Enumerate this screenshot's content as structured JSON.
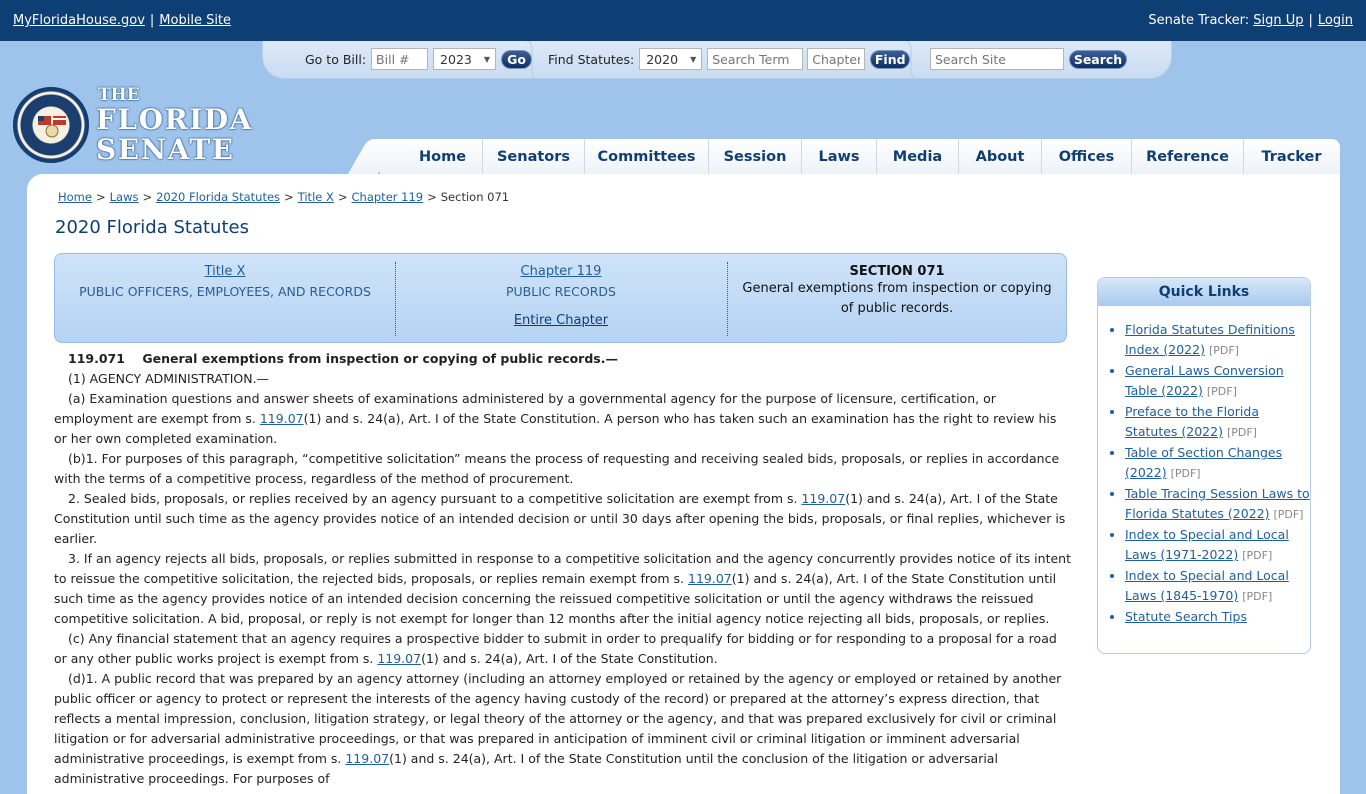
{
  "topbar": {
    "left_link_1": "MyFloridaHouse.gov",
    "left_sep": "|",
    "left_link_2": "Mobile Site",
    "right_label": "Senate Tracker:",
    "right_link_1": "Sign Up",
    "right_sep": "|",
    "right_link_2": "Login"
  },
  "tray": {
    "goto_label": "Go to Bill:",
    "bill_placeholder": "Bill #",
    "bill_year": "2023",
    "go_label": "Go",
    "find_label": "Find Statutes:",
    "statute_year": "2020",
    "term_placeholder": "Search Term",
    "chapter_placeholder": "Chapter",
    "find_button": "Find",
    "site_placeholder": "Search Site",
    "search_button": "Search"
  },
  "logo": {
    "the": "THE",
    "florida": "FLORIDA",
    "senate": "SENATE"
  },
  "nav": [
    "Home",
    "Senators",
    "Committees",
    "Session",
    "Laws",
    "Media",
    "About",
    "Offices",
    "Reference",
    "Tracker"
  ],
  "breadcrumb": {
    "home": "Home",
    "laws": "Laws",
    "statutes": "2020 Florida Statutes",
    "title": "Title X",
    "chapter": "Chapter 119",
    "current": "Section 071",
    "gt": ">"
  },
  "page_title": "2020 Florida Statutes",
  "heading": {
    "title_link": "Title X",
    "title_name": "PUBLIC OFFICERS, EMPLOYEES, AND RECORDS",
    "chapter_link": "Chapter 119",
    "chapter_name": "PUBLIC RECORDS",
    "entire_chapter": "Entire Chapter",
    "section_label": "SECTION 071",
    "section_name": "General exemptions from inspection or copying of public records."
  },
  "statute": {
    "number": "119.071",
    "catchline": "General exemptions from inspection or copying of public records.—",
    "p1": "(1)    AGENCY ADMINISTRATION.—",
    "p2a": "(a)    Examination questions and answer sheets of examinations administered by a governmental agency for the purpose of licensure, certification, or employment are exempt from s. ",
    "p2link": "119.07",
    "p2b": "(1) and s. 24(a), Art. I of the State Constitution. A person who has taken such an examination has the right to review his or her own completed examination.",
    "p3": "(b)1.    For purposes of this paragraph, “competitive solicitation” means the process of requesting and receiving sealed bids, proposals, or replies in accordance with the terms of a competitive process, regardless of the method of procurement.",
    "p4a": "2.    Sealed bids, proposals, or replies received by an agency pursuant to a competitive solicitation are exempt from s. ",
    "p4link": "119.07",
    "p4b": "(1) and s. 24(a), Art. I of the State Constitution until such time as the agency provides notice of an intended decision or until 30 days after opening the bids, proposals, or final replies, whichever is earlier.",
    "p5a": "3.    If an agency rejects all bids, proposals, or replies submitted in response to a competitive solicitation and the agency concurrently provides notice of its intent to reissue the competitive solicitation, the rejected bids, proposals, or replies remain exempt from s. ",
    "p5link": "119.07",
    "p5b": "(1) and s. 24(a), Art. I of the State Constitution until such time as the agency provides notice of an intended decision concerning the reissued competitive solicitation or until the agency withdraws the reissued competitive solicitation. A bid, proposal, or reply is not exempt for longer than 12 months after the initial agency notice rejecting all bids, proposals, or replies.",
    "p6a": "(c)    Any financial statement that an agency requires a prospective bidder to submit in order to prequalify for bidding or for responding to a proposal for a road or any other public works project is exempt from s. ",
    "p6link": "119.07",
    "p6b": "(1) and s. 24(a), Art. I of the State Constitution.",
    "p7a": "(d)1.    A public record that was prepared by an agency attorney (including an attorney employed or retained by the agency or employed or retained by another public officer or agency to protect or represent the interests of the agency having custody of the record) or prepared at the attorney’s express direction, that reflects a mental impression, conclusion, litigation strategy, or legal theory of the attorney or the agency, and that was prepared exclusively for civil or criminal litigation or for adversarial administrative proceedings, or that was prepared in anticipation of imminent civil or criminal litigation or imminent adversarial administrative proceedings, is exempt from s. ",
    "p7link": "119.07",
    "p7b": "(1) and s. 24(a), Art. I of the State Constitution until the conclusion of the litigation or adversarial administrative proceedings. For purposes of"
  },
  "quick_links": {
    "title": "Quick Links",
    "pdf_tag": "[PDF]",
    "items": [
      "Florida Statutes Definitions Index (2022)",
      "General Laws Conversion Table (2022)",
      "Preface to the Florida Statutes (2022)",
      "Table of Section Changes (2022)",
      "Table Tracing Session Laws to Florida Statutes (2022)",
      "Index to Special and Local Laws (1971-2022)",
      "Index to Special and Local Laws (1845-1970)",
      "Statute Search Tips"
    ]
  }
}
